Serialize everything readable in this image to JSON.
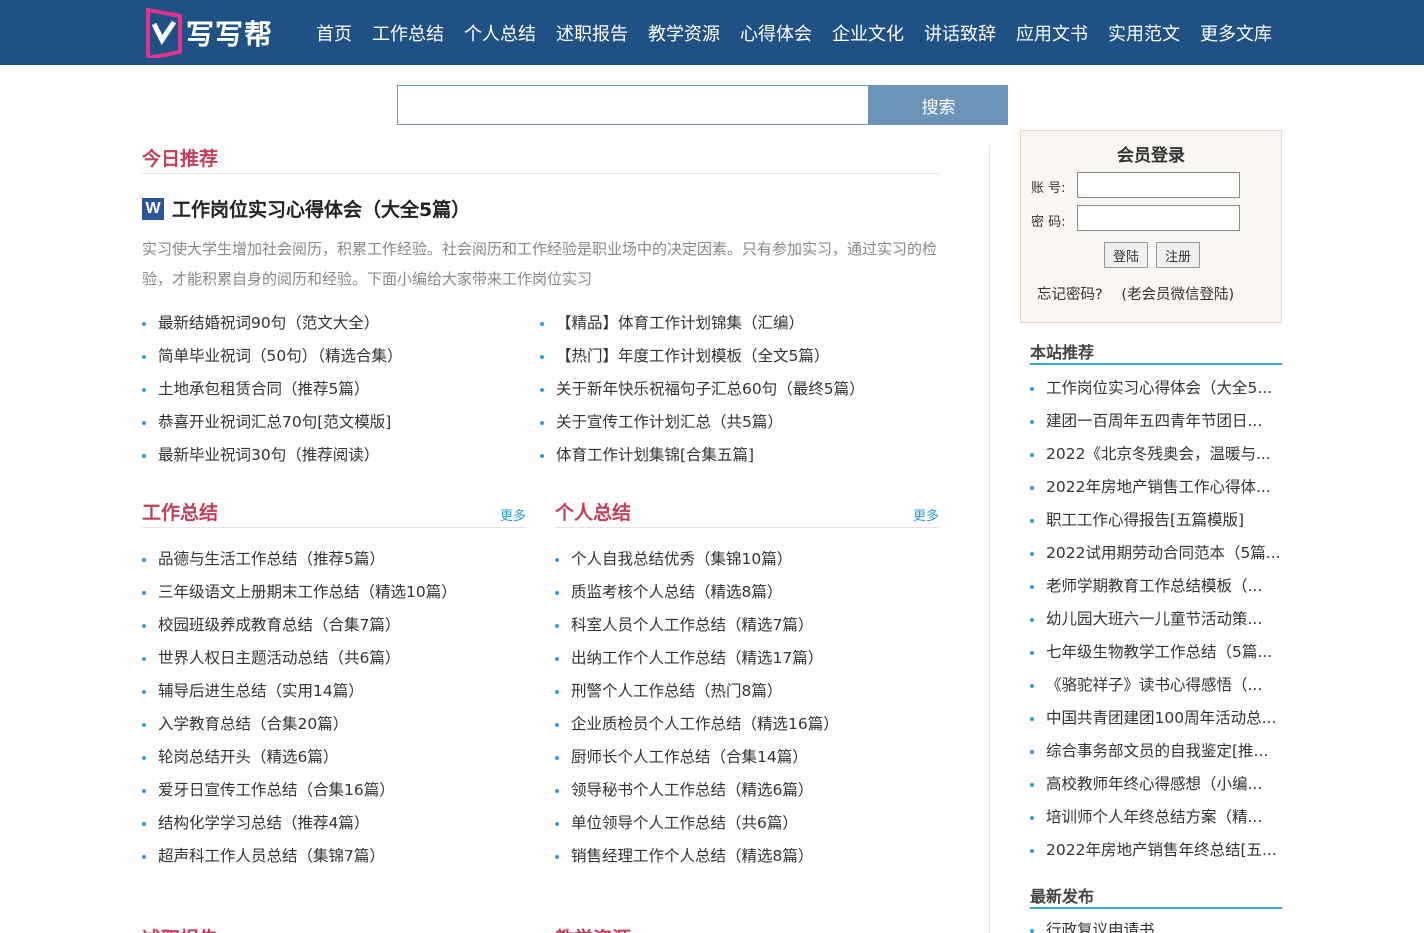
{
  "header": {
    "logo_text": "写写帮",
    "nav": [
      "首页",
      "工作总结",
      "个人总结",
      "述职报告",
      "教学资源",
      "心得体会",
      "企业文化",
      "讲话致辞",
      "应用文书",
      "实用范文",
      "更多文库"
    ]
  },
  "search": {
    "placeholder": "",
    "button": "搜索"
  },
  "today": {
    "title": "今日推荐",
    "feature_title": "工作岗位实习心得体会（大全5篇）",
    "feature_desc": "实习使大学生增加社会阅历，积累工作经验。社会阅历和工作经验是职业场中的决定因素。只有参加实习，通过实习的检验，才能积累自身的阅历和经验。下面小编给大家带来工作岗位实习",
    "left": [
      "最新结婚祝词90句（范文大全）",
      "简单毕业祝词（50句）（精选合集）",
      "土地承包租赁合同（推荐5篇）",
      "恭喜开业祝词汇总70句[范文模版]",
      "最新毕业祝词30句（推荐阅读）"
    ],
    "right": [
      "【精品】体育工作计划锦集（汇编）",
      "【热门】年度工作计划模板（全文5篇）",
      "关于新年快乐祝福句子汇总60句（最终5篇）",
      "关于宣传工作计划汇总（共5篇）",
      "体育工作计划集锦[合集五篇]"
    ]
  },
  "work_summary": {
    "title": "工作总结",
    "more": "更多",
    "items": [
      "品德与生活工作总结（推荐5篇）",
      "三年级语文上册期末工作总结（精选10篇）",
      "校园班级养成教育总结（合集7篇）",
      "世界人权日主题活动总结（共6篇）",
      "辅导后进生总结（实用14篇）",
      "入学教育总结（合集20篇）",
      "轮岗总结开头（精选6篇）",
      "爱牙日宣传工作总结（合集16篇）",
      "结构化学学习总结（推荐4篇）",
      "超声科工作人员总结（集锦7篇）"
    ]
  },
  "personal_summary": {
    "title": "个人总结",
    "more": "更多",
    "items": [
      "个人自我总结优秀（集锦10篇）",
      "质监考核个人总结（精选8篇）",
      "科室人员个人工作总结（精选7篇）",
      "出纳工作个人工作总结（精选17篇）",
      "刑警个人工作总结（热门8篇）",
      "企业质检员个人工作总结（精选16篇）",
      "厨师长个人工作总结（合集14篇）",
      "领导秘书个人工作总结（精选6篇）",
      "单位领导个人工作总结（共6篇）",
      "销售经理工作个人总结（精选8篇）"
    ]
  },
  "next_sections": [
    "述职报告",
    "教学资源"
  ],
  "login": {
    "title": "会员登录",
    "account_label": "账 号:",
    "password_label": "密 码:",
    "login_btn": "登陆",
    "register_btn": "注册",
    "forgot": "忘记密码?",
    "wechat": "(老会员微信登陆)"
  },
  "site_recommend": {
    "title": "本站推荐",
    "items": [
      "工作岗位实习心得体会（大全5...",
      "建团一百周年五四青年节团日...",
      "2022《北京冬残奥会，温暖与...",
      "2022年房地产销售工作心得体...",
      "职工工作心得报告[五篇模版]",
      "2022试用期劳动合同范本（5篇...",
      "老师学期教育工作总结模板（...",
      "幼儿园大班六一儿童节活动策...",
      "七年级生物教学工作总结（5篇...",
      "《骆驼祥子》读书心得感悟（...",
      "中国共青团建团100周年活动总...",
      "综合事务部文员的自我鉴定[推...",
      "高校教师年终心得感想（小编...",
      "培训师个人年终总结方案（精...",
      "2022年房地产销售年终总结[五..."
    ]
  },
  "latest": {
    "title": "最新发布",
    "items": [
      "行政复议申请书"
    ]
  },
  "colors": {
    "header_bg": "#1f5185",
    "section_title": "#c0405a",
    "accent": "#2a9fd6",
    "search_btn": "#6b94b8"
  }
}
